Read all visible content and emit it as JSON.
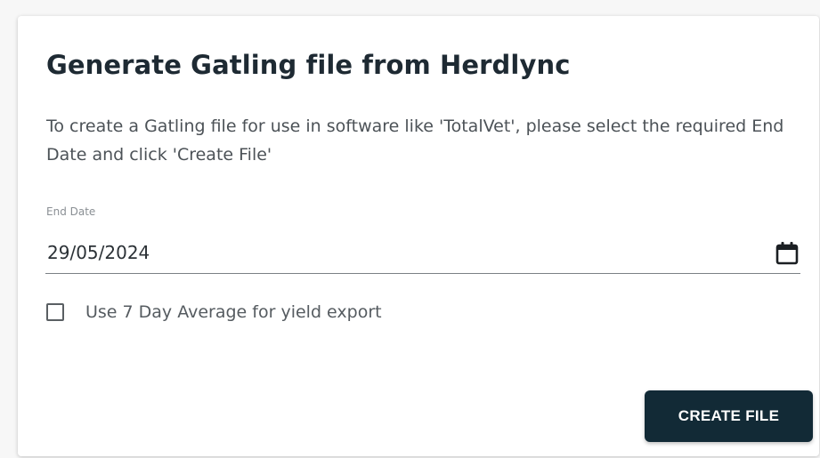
{
  "dialog": {
    "title": "Generate Gatling file from Herdlync",
    "description": "To create a Gatling file for use in software like 'TotalVet', please select the required End Date and click 'Create File'"
  },
  "end_date": {
    "label": "End Date",
    "value": "29/05/2024",
    "icon": "calendar-icon"
  },
  "seven_day_average": {
    "label": "Use 7 Day Average for yield export",
    "checked": false
  },
  "actions": {
    "create_label": "CREATE FILE"
  },
  "colors": {
    "button_bg": "#122a36",
    "title_text": "#1e2a33",
    "body_text": "#4c5257"
  }
}
